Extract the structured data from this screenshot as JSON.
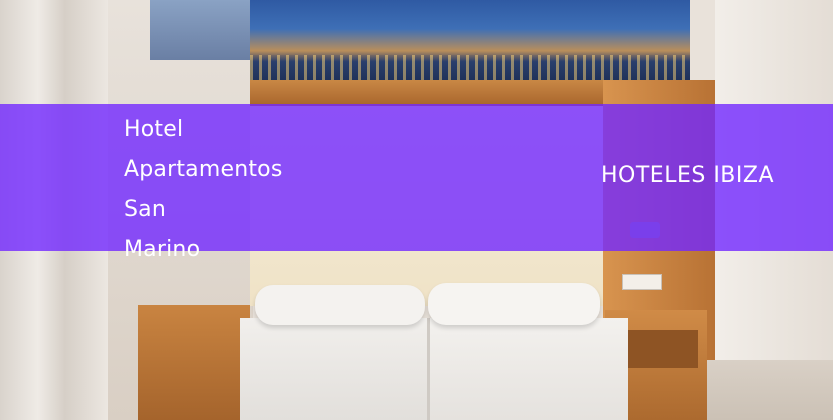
{
  "banner": {
    "hotel_name": "Hotel\nApartamentos\nSan\nMarino",
    "category": "HOTELES IBIZA",
    "overlay_color": "#7228ff"
  },
  "photo": {
    "subject": "hotel-room-twin-beds"
  }
}
